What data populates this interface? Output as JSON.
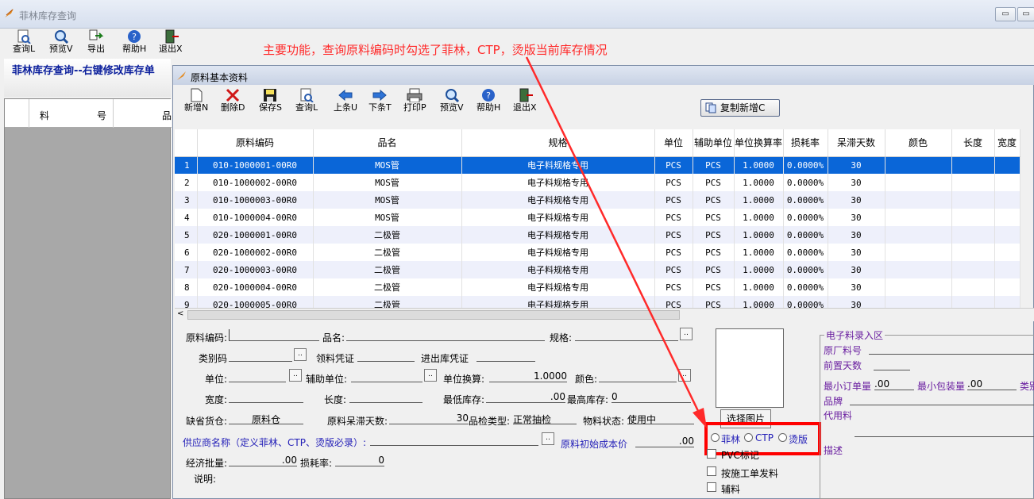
{
  "outer_window": {
    "title": "菲林库存查询",
    "min_label": "▭",
    "close_label": "▭"
  },
  "outer_toolbar": [
    {
      "label": "查询L",
      "icon": "doc-search-icon"
    },
    {
      "label": "预览V",
      "icon": "magnifier-icon"
    },
    {
      "label": "导出",
      "icon": "export-icon"
    },
    {
      "label": "帮助H",
      "icon": "help-icon"
    },
    {
      "label": "退出X",
      "icon": "exit-door-icon"
    }
  ],
  "sidebar": {
    "title": "菲林库存查询--右键修改库存单",
    "col1": "料",
    "col2": "号",
    "col3": "品"
  },
  "annotation": "主要功能，查询原料编码时勾选了菲林，CTP，烫版当前库存情况",
  "inner_window": {
    "title": "原料基本资料"
  },
  "inner_toolbar": [
    {
      "label": "新增N",
      "icon": "new-doc-icon"
    },
    {
      "label": "删除D",
      "icon": "delete-x-icon"
    },
    {
      "label": "保存S",
      "icon": "save-disk-icon"
    },
    {
      "label": "查询L",
      "icon": "doc-search-icon"
    },
    {
      "label": "上条U",
      "icon": "arrow-left-icon"
    },
    {
      "label": "下条T",
      "icon": "arrow-right-icon"
    },
    {
      "label": "打印P",
      "icon": "printer-icon"
    },
    {
      "label": "预览V",
      "icon": "magnifier-icon"
    },
    {
      "label": "帮助H",
      "icon": "help-icon"
    },
    {
      "label": "退出X",
      "icon": "exit-door-icon"
    }
  ],
  "copy_button": "复制新增C",
  "grid": {
    "columns": [
      "原料编码",
      "品名",
      "规格",
      "单位",
      "辅助单位",
      "单位换算率",
      "损耗率",
      "呆滞天数",
      "颜色",
      "长度",
      "宽度"
    ],
    "rows": [
      [
        "1",
        "010-1000001-00R0",
        "MOS管",
        "电子料规格专用",
        "PCS",
        "PCS",
        "1.0000",
        "0.0000%",
        "30"
      ],
      [
        "2",
        "010-1000002-00R0",
        "MOS管",
        "电子料规格专用",
        "PCS",
        "PCS",
        "1.0000",
        "0.0000%",
        "30"
      ],
      [
        "3",
        "010-1000003-00R0",
        "MOS管",
        "电子料规格专用",
        "PCS",
        "PCS",
        "1.0000",
        "0.0000%",
        "30"
      ],
      [
        "4",
        "010-1000004-00R0",
        "MOS管",
        "电子料规格专用",
        "PCS",
        "PCS",
        "1.0000",
        "0.0000%",
        "30"
      ],
      [
        "5",
        "020-1000001-00R0",
        "二极管",
        "电子料规格专用",
        "PCS",
        "PCS",
        "1.0000",
        "0.0000%",
        "30"
      ],
      [
        "6",
        "020-1000002-00R0",
        "二极管",
        "电子料规格专用",
        "PCS",
        "PCS",
        "1.0000",
        "0.0000%",
        "30"
      ],
      [
        "7",
        "020-1000003-00R0",
        "二极管",
        "电子料规格专用",
        "PCS",
        "PCS",
        "1.0000",
        "0.0000%",
        "30"
      ],
      [
        "8",
        "020-1000004-00R0",
        "二极管",
        "电子料规格专用",
        "PCS",
        "PCS",
        "1.0000",
        "0.0000%",
        "30"
      ],
      [
        "9",
        "020-1000005-00R0",
        "二极管",
        "电子料规格专用",
        "PCS",
        "PCS",
        "1.0000",
        "0.0000%",
        "30"
      ]
    ]
  },
  "form": {
    "code_label": "原料编码:",
    "name_label": "品名:",
    "spec_label": "规格:",
    "category_label": "类别码",
    "issue_label": "领料凭证",
    "io_label": "进出库凭证",
    "unit_label": "单位:",
    "aux_unit_label": "辅助单位:",
    "conv_label": "单位换算:",
    "conv_value": "1.0000",
    "color_label": "颜色:",
    "width_label": "宽度:",
    "length_label": "长度:",
    "min_stock_label": "最低库存:",
    "min_stock_value": ".00",
    "max_stock_label": "最高库存:",
    "max_stock_value": "0",
    "default_wh_label": "缺省货仓:",
    "default_wh_value": "原料仓",
    "stale_label": "原料呆滞天数:",
    "stale_value": "30",
    "qc_label": "品检类型:",
    "qc_value": "正常抽检",
    "status_label": "物料状态:",
    "status_value": "使用中",
    "supplier_label": "供应商名称（定义菲林、CTP、烫版必录）:",
    "init_cost_label": "原料初始成本价",
    "init_cost_value": ".00",
    "eco_batch_label": "经济批量:",
    "eco_batch_value": ".00",
    "loss_label": "损耗率:",
    "loss_value": "0",
    "desc_label": "说明:",
    "select_image": "选择图片",
    "radio_feilin": "菲林",
    "radio_ctp": "CTP",
    "radio_tangban": "烫版",
    "pvc_label": "PVC标记",
    "work_order_label": "按施工单发料",
    "aux_mat_label": "辅料"
  },
  "electronic": {
    "title": "电子料录入区",
    "mfr_part": "原厂料号",
    "lead_days": "前置天数",
    "min_order": "最小订单量",
    "min_order_value": ".00",
    "min_pack": "最小包装量",
    "min_pack_value": ".00",
    "cut": "类别",
    "brand": "品牌",
    "proxy": "代用料",
    "desc": "描述"
  },
  "colors": {
    "selected_row": "#0a66d8",
    "annotation": "#ff2a2a",
    "purple": "#6a1fa0"
  }
}
